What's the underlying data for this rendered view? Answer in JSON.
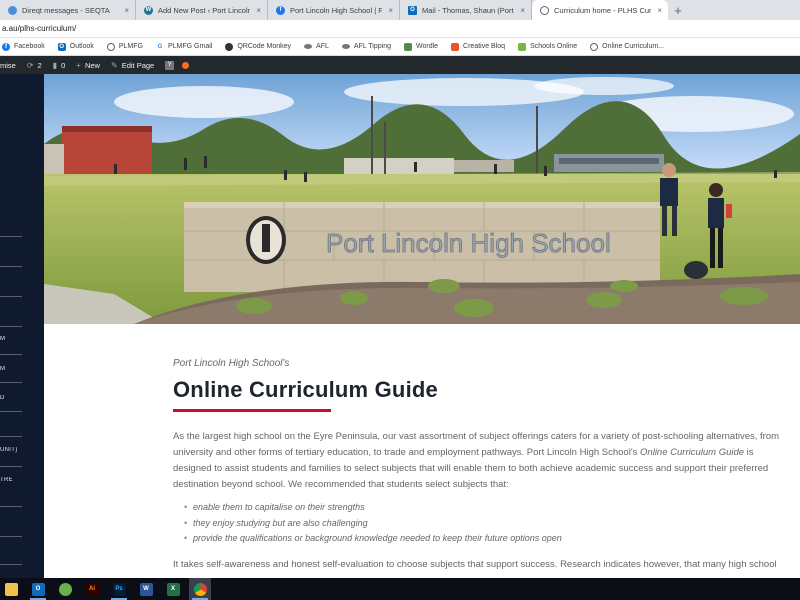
{
  "browser": {
    "tabs": [
      {
        "title": "Direqt messages - SEQTA",
        "color": "#4a90d9",
        "letter": ""
      },
      {
        "title": "Add New Post ‹ Port Lincoln High",
        "color": "#21759b",
        "letter": "W"
      },
      {
        "title": "Port Lincoln High School | Facebo",
        "color": "#1877f2",
        "letter": "f"
      },
      {
        "title": "Mail - Thomas, Shaun (Port Linco",
        "color": "#0f6cbd",
        "letter": "O"
      },
      {
        "title": "Curriculum home - PLHS Curricu",
        "color": "#5f6368",
        "letter": ""
      }
    ],
    "new_tab": "+",
    "close": "×",
    "address": "a.au/plhs-curriculum/"
  },
  "bookmarks": [
    {
      "label": "Facebook",
      "color": "#1877f2",
      "letter": "f"
    },
    {
      "label": "Outlook",
      "color": "#0f6cbd",
      "letter": "O"
    },
    {
      "label": "PLMFG",
      "color": "#5f6368",
      "letter": ""
    },
    {
      "label": "PLMFG Gmail",
      "color": "#ffffff",
      "letter": "G"
    },
    {
      "label": "QRCode Monkey",
      "color": "#333333",
      "letter": ""
    },
    {
      "label": "AFL",
      "color": "#777777",
      "letter": ""
    },
    {
      "label": "AFL Tipping",
      "color": "#777777",
      "letter": ""
    },
    {
      "label": "Wordle",
      "color": "#538d4e",
      "letter": ""
    },
    {
      "label": "Creative Bloq",
      "color": "#e8532a",
      "letter": ""
    },
    {
      "label": "Schools Online",
      "color": "#7cb342",
      "letter": ""
    },
    {
      "label": "Online Curriculum...",
      "color": "#5f6368",
      "letter": ""
    }
  ],
  "adminbar": {
    "site": "mise",
    "updates_count": "2",
    "comments_count": "0",
    "new_label": "New",
    "edit_label": "Edit Page"
  },
  "sidebar": {
    "links": [
      "M",
      "M",
      "D",
      "UNIT)",
      "TRE"
    ]
  },
  "article": {
    "kicker": "Port Lincoln High School's",
    "title": "Online Curriculum Guide",
    "para1_a": "As the largest high school on the Eyre Peninsula, our vast assortment of subject offerings caters for a variety of post-schooling alternatives, from university and other forms of tertiary education, to trade and employment pathways. Port Lincoln High School's ",
    "para1_em": "Online Curriculum Guide",
    "para1_b": " is designed to assist students and families to select subjects that will enable them to both achieve academic success and support their preferred destination beyond school. We recommended that students select subjects that:",
    "bullets": [
      "enable them to capitalise on their strengths",
      "they enjoy studying but are also challenging",
      "provide the qualifications or background knowledge needed to keep their future options open"
    ],
    "para2": "It takes self-awareness and honest self-evaluation to choose subjects that support success. Research indicates however, that many high school"
  },
  "hero": {
    "sign_text": "Port Lincoln High School"
  },
  "colors": {
    "accent": "#c8102e",
    "sidebar": "#101a2e",
    "adminbar": "#23282d"
  }
}
